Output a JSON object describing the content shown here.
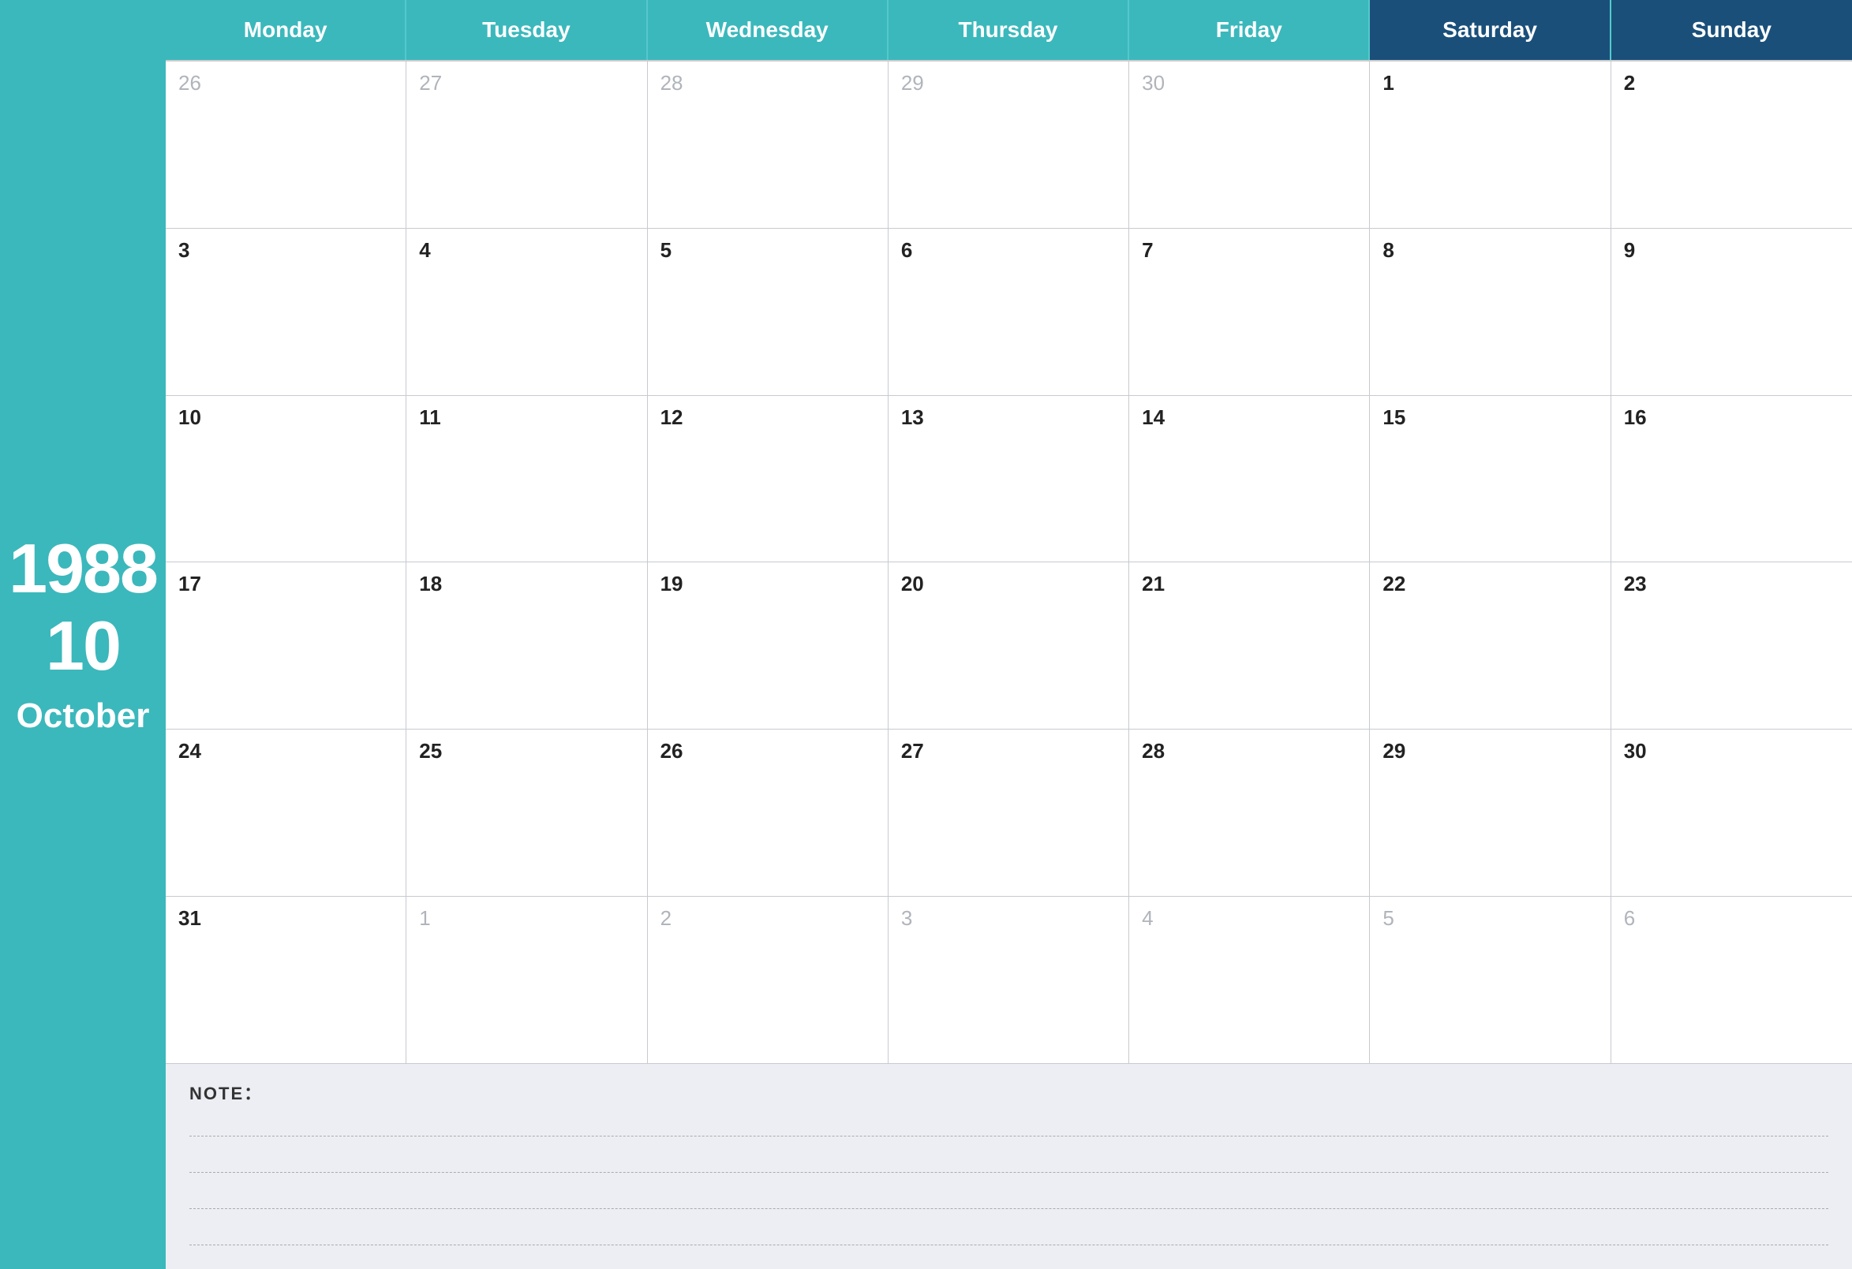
{
  "sidebar": {
    "year": "1988",
    "month_number": "10",
    "month_name": "October"
  },
  "header": {
    "days": [
      {
        "label": "Monday",
        "type": "weekday"
      },
      {
        "label": "Tuesday",
        "type": "weekday"
      },
      {
        "label": "Wednesday",
        "type": "weekday"
      },
      {
        "label": "Thursday",
        "type": "weekday"
      },
      {
        "label": "Friday",
        "type": "weekday"
      },
      {
        "label": "Saturday",
        "type": "weekend"
      },
      {
        "label": "Sunday",
        "type": "weekend"
      }
    ]
  },
  "weeks": [
    [
      {
        "day": "26",
        "other": true
      },
      {
        "day": "27",
        "other": true
      },
      {
        "day": "28",
        "other": true
      },
      {
        "day": "29",
        "other": true
      },
      {
        "day": "30",
        "other": true
      },
      {
        "day": "1",
        "other": false
      },
      {
        "day": "2",
        "other": false
      }
    ],
    [
      {
        "day": "3",
        "other": false
      },
      {
        "day": "4",
        "other": false
      },
      {
        "day": "5",
        "other": false
      },
      {
        "day": "6",
        "other": false
      },
      {
        "day": "7",
        "other": false
      },
      {
        "day": "8",
        "other": false
      },
      {
        "day": "9",
        "other": false
      }
    ],
    [
      {
        "day": "10",
        "other": false
      },
      {
        "day": "11",
        "other": false
      },
      {
        "day": "12",
        "other": false
      },
      {
        "day": "13",
        "other": false
      },
      {
        "day": "14",
        "other": false
      },
      {
        "day": "15",
        "other": false
      },
      {
        "day": "16",
        "other": false
      }
    ],
    [
      {
        "day": "17",
        "other": false
      },
      {
        "day": "18",
        "other": false
      },
      {
        "day": "19",
        "other": false
      },
      {
        "day": "20",
        "other": false
      },
      {
        "day": "21",
        "other": false
      },
      {
        "day": "22",
        "other": false
      },
      {
        "day": "23",
        "other": false
      }
    ],
    [
      {
        "day": "24",
        "other": false
      },
      {
        "day": "25",
        "other": false
      },
      {
        "day": "26",
        "other": false
      },
      {
        "day": "27",
        "other": false
      },
      {
        "day": "28",
        "other": false
      },
      {
        "day": "29",
        "other": false
      },
      {
        "day": "30",
        "other": false
      }
    ],
    [
      {
        "day": "31",
        "other": false
      },
      {
        "day": "1",
        "other": true
      },
      {
        "day": "2",
        "other": true
      },
      {
        "day": "3",
        "other": true
      },
      {
        "day": "4",
        "other": true
      },
      {
        "day": "5",
        "other": true
      },
      {
        "day": "6",
        "other": true
      }
    ]
  ],
  "note": {
    "label": "NOTE："
  },
  "colors": {
    "teal": "#3bb8bc",
    "dark_blue": "#1a4f7a",
    "bg": "#eceef3"
  }
}
